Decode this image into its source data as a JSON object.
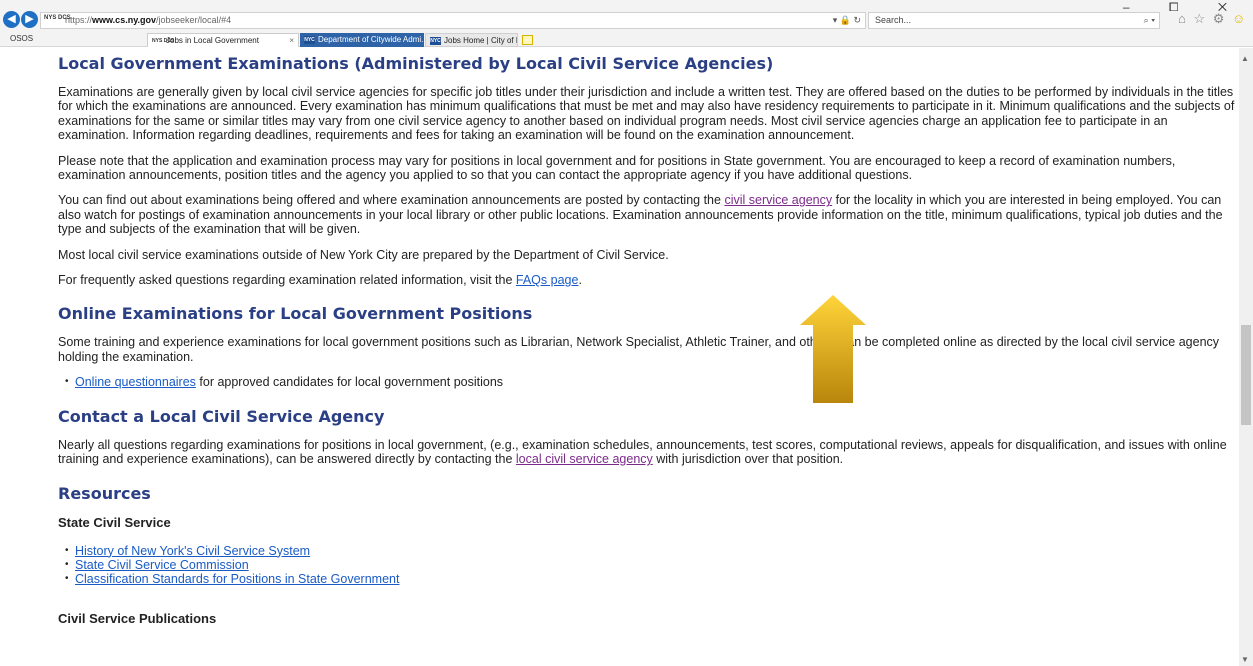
{
  "browser": {
    "url_scheme": "https://",
    "url_host": "www.cs.ny.gov",
    "url_path": "/jobseeker/local/#4",
    "address_favicon": "NYS DCS",
    "address_controls": "▾ 🔒 ↻",
    "search_placeholder": "Search...",
    "search_icon": "⌕ ▾",
    "favorites_label": "OSOS",
    "tabs": [
      {
        "favicon": "NYS DCS",
        "label": "Jobs in Local Government",
        "close": "×"
      },
      {
        "favicon": "NYC",
        "label": "Department of Citywide Admi..."
      },
      {
        "favicon": "NYC",
        "label": "Jobs Home | City of New York"
      }
    ],
    "window_controls": "–  ⧠  ✕",
    "toolbar_icons": "⌂ ☆ ⚙"
  },
  "page": {
    "s1_title": "Local Government Examinations (Administered by Local Civil Service Agencies)",
    "s1_p1": "Examinations are generally given by local civil service agencies for specific job titles under their jurisdiction and include a written test. They are offered based on the duties to be performed by individuals in the titles for which the examinations are announced. Every examination has minimum qualifications that must be met and may also have residency requirements to participate in it. Minimum qualifications and the subjects of examinations for the same or similar titles may vary from one civil service agency to another based on individual program needs. Most civil service agencies charge an application fee to participate in an examination. Information regarding deadlines, requirements and fees for taking an examination will be found on the examination announcement.",
    "s1_p2": "Please note that the application and examination process may vary for positions in local government and for positions in State government. You are encouraged to keep a record of examination numbers, examination announcements, position titles and the agency you applied to so that you can contact the appropriate agency if you have additional questions.",
    "s1_p3_a": "You can find out about examinations being offered and where examination announcements are posted by contacting the ",
    "s1_p3_link": "civil service agency",
    "s1_p3_b": " for the locality in which you are interested in being employed. You can also watch for postings of examination announcements in your local library or other public locations. Examination announcements provide information on the title, minimum qualifications, typical job duties and the type and subjects of the examination that will be given.",
    "s1_p4": "Most local civil service examinations outside of New York City are prepared by the Department of Civil Service.",
    "s1_p5_a": "For frequently asked questions regarding examination related information, visit the ",
    "s1_p5_link": "FAQs page",
    "s1_p5_b": ".",
    "s2_title": "Online Examinations for Local Government Positions",
    "s2_p1": "Some training and experience examinations for local government positions such as Librarian, Network Specialist, Athletic Trainer, and others, can be completed online as directed by the local civil service agency holding the examination.",
    "s2_li_link": "Online questionnaires",
    "s2_li_text": " for approved candidates for local government positions",
    "s3_title": "Contact a Local Civil Service Agency",
    "s3_p1_a": "Nearly all questions regarding examinations for positions in local government, (e.g., examination schedules, announcements, test scores, computational reviews, appeals for disqualification, and issues with online training and experience examinations), can be answered directly by contacting the ",
    "s3_p1_link": "local civil service agency",
    "s3_p1_b": " with jurisdiction over that position.",
    "s4_title": "Resources",
    "s4_sub1": "State Civil Service",
    "s4_links": [
      "History of New York's Civil Service System",
      "State Civil Service Commission",
      "Classification Standards for Positions in State Government"
    ],
    "s4_sub2": "Civil Service Publications"
  },
  "scrollbar": {
    "up": "▲",
    "down": "▼"
  },
  "colors": {
    "heading": "#2a3f84",
    "link": "#1a5bc6",
    "visited_link": "#7b2a8a",
    "arrow_top": "#ffd43a",
    "arrow_bottom": "#b8860b"
  }
}
